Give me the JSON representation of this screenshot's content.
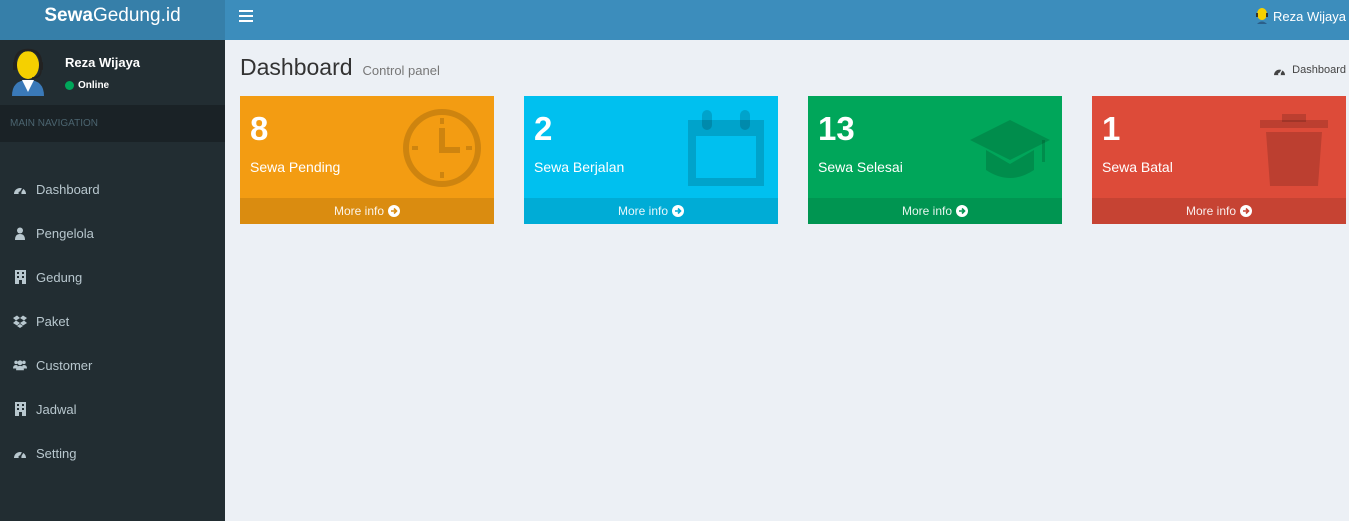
{
  "brand": {
    "bold": "Sewa",
    "rest": "Gedung.id"
  },
  "header": {
    "user_name": "Reza Wijaya",
    "menu_icon": "hamburger-icon"
  },
  "sidebar": {
    "user_name": "Reza Wijaya",
    "status": "Online",
    "section_title": "MAIN NAVIGATION",
    "items": [
      {
        "label": "Dashboard",
        "icon": "dashboard-icon"
      },
      {
        "label": "Pengelola",
        "icon": "user-icon"
      },
      {
        "label": "Gedung",
        "icon": "building-icon"
      },
      {
        "label": "Paket",
        "icon": "dropbox-icon"
      },
      {
        "label": "Customer",
        "icon": "users-icon"
      },
      {
        "label": "Jadwal",
        "icon": "building-icon"
      },
      {
        "label": "Setting",
        "icon": "dashboard-icon"
      }
    ]
  },
  "page": {
    "title": "Dashboard",
    "subtitle": "Control panel",
    "breadcrumb": "Dashboard"
  },
  "boxes": [
    {
      "value": "8",
      "label": "Sewa Pending",
      "footer": "More info",
      "color": "#f39c12",
      "footer_color": "#da8c10",
      "icon": "clock-icon"
    },
    {
      "value": "2",
      "label": "Sewa Berjalan",
      "footer": "More info",
      "color": "#00c0ef",
      "footer_color": "#00acd6",
      "icon": "calendar-icon"
    },
    {
      "value": "13",
      "label": "Sewa Selesai",
      "footer": "More info",
      "color": "#00a65a",
      "footer_color": "#009551",
      "icon": "graduation-cap-icon"
    },
    {
      "value": "1",
      "label": "Sewa Batal",
      "footer": "More info",
      "color": "#dd4b39",
      "footer_color": "#c64333",
      "icon": "trash-icon"
    }
  ]
}
